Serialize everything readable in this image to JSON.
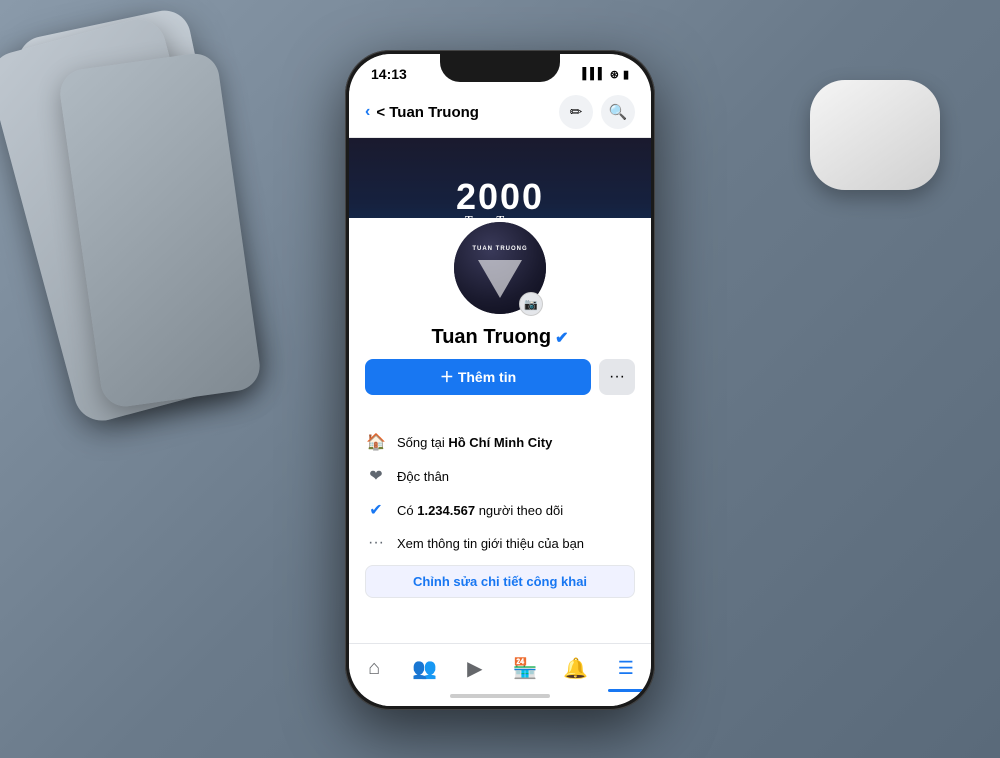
{
  "scene": {
    "background_color": "#7a8a9a"
  },
  "status_bar": {
    "time": "14:13",
    "signal_icon": "▌▌▌",
    "wifi_icon": "wifi",
    "battery_icon": "🔋"
  },
  "nav": {
    "back_label": "< Tuan Truong",
    "edit_icon": "pencil",
    "search_icon": "search"
  },
  "cover": {
    "title_number": "2000",
    "signature": "Tuan Truong",
    "camera_icon": "camera"
  },
  "profile": {
    "name": "Tuan Truong",
    "verified": true,
    "avatar_alt": "Tuan Truong profile picture",
    "camera_icon": "camera",
    "add_info_button": "Thêm tin",
    "more_button": "···"
  },
  "info_items": [
    {
      "icon": "🏠",
      "text_prefix": "Sống tại ",
      "text_bold": "Hồ Chí Minh City"
    },
    {
      "icon": "❤",
      "text": "Độc thân"
    },
    {
      "icon": "✔",
      "text_prefix": "Có ",
      "text_bold": "1.234.567",
      "text_suffix": " người theo dõi"
    },
    {
      "icon": "···",
      "text": "Xem thông tin giới thiệu của bạn"
    }
  ],
  "edit_public_button": "Chỉnh sửa chi tiết công khai",
  "bottom_nav": {
    "items": [
      {
        "icon": "home",
        "label": "Home",
        "active": false
      },
      {
        "icon": "people",
        "label": "Friends",
        "active": false
      },
      {
        "icon": "play",
        "label": "Video",
        "active": false
      },
      {
        "icon": "store",
        "label": "Marketplace",
        "active": false
      },
      {
        "icon": "bell",
        "label": "Notifications",
        "active": false
      },
      {
        "icon": "menu",
        "label": "Menu",
        "active": true
      }
    ]
  }
}
